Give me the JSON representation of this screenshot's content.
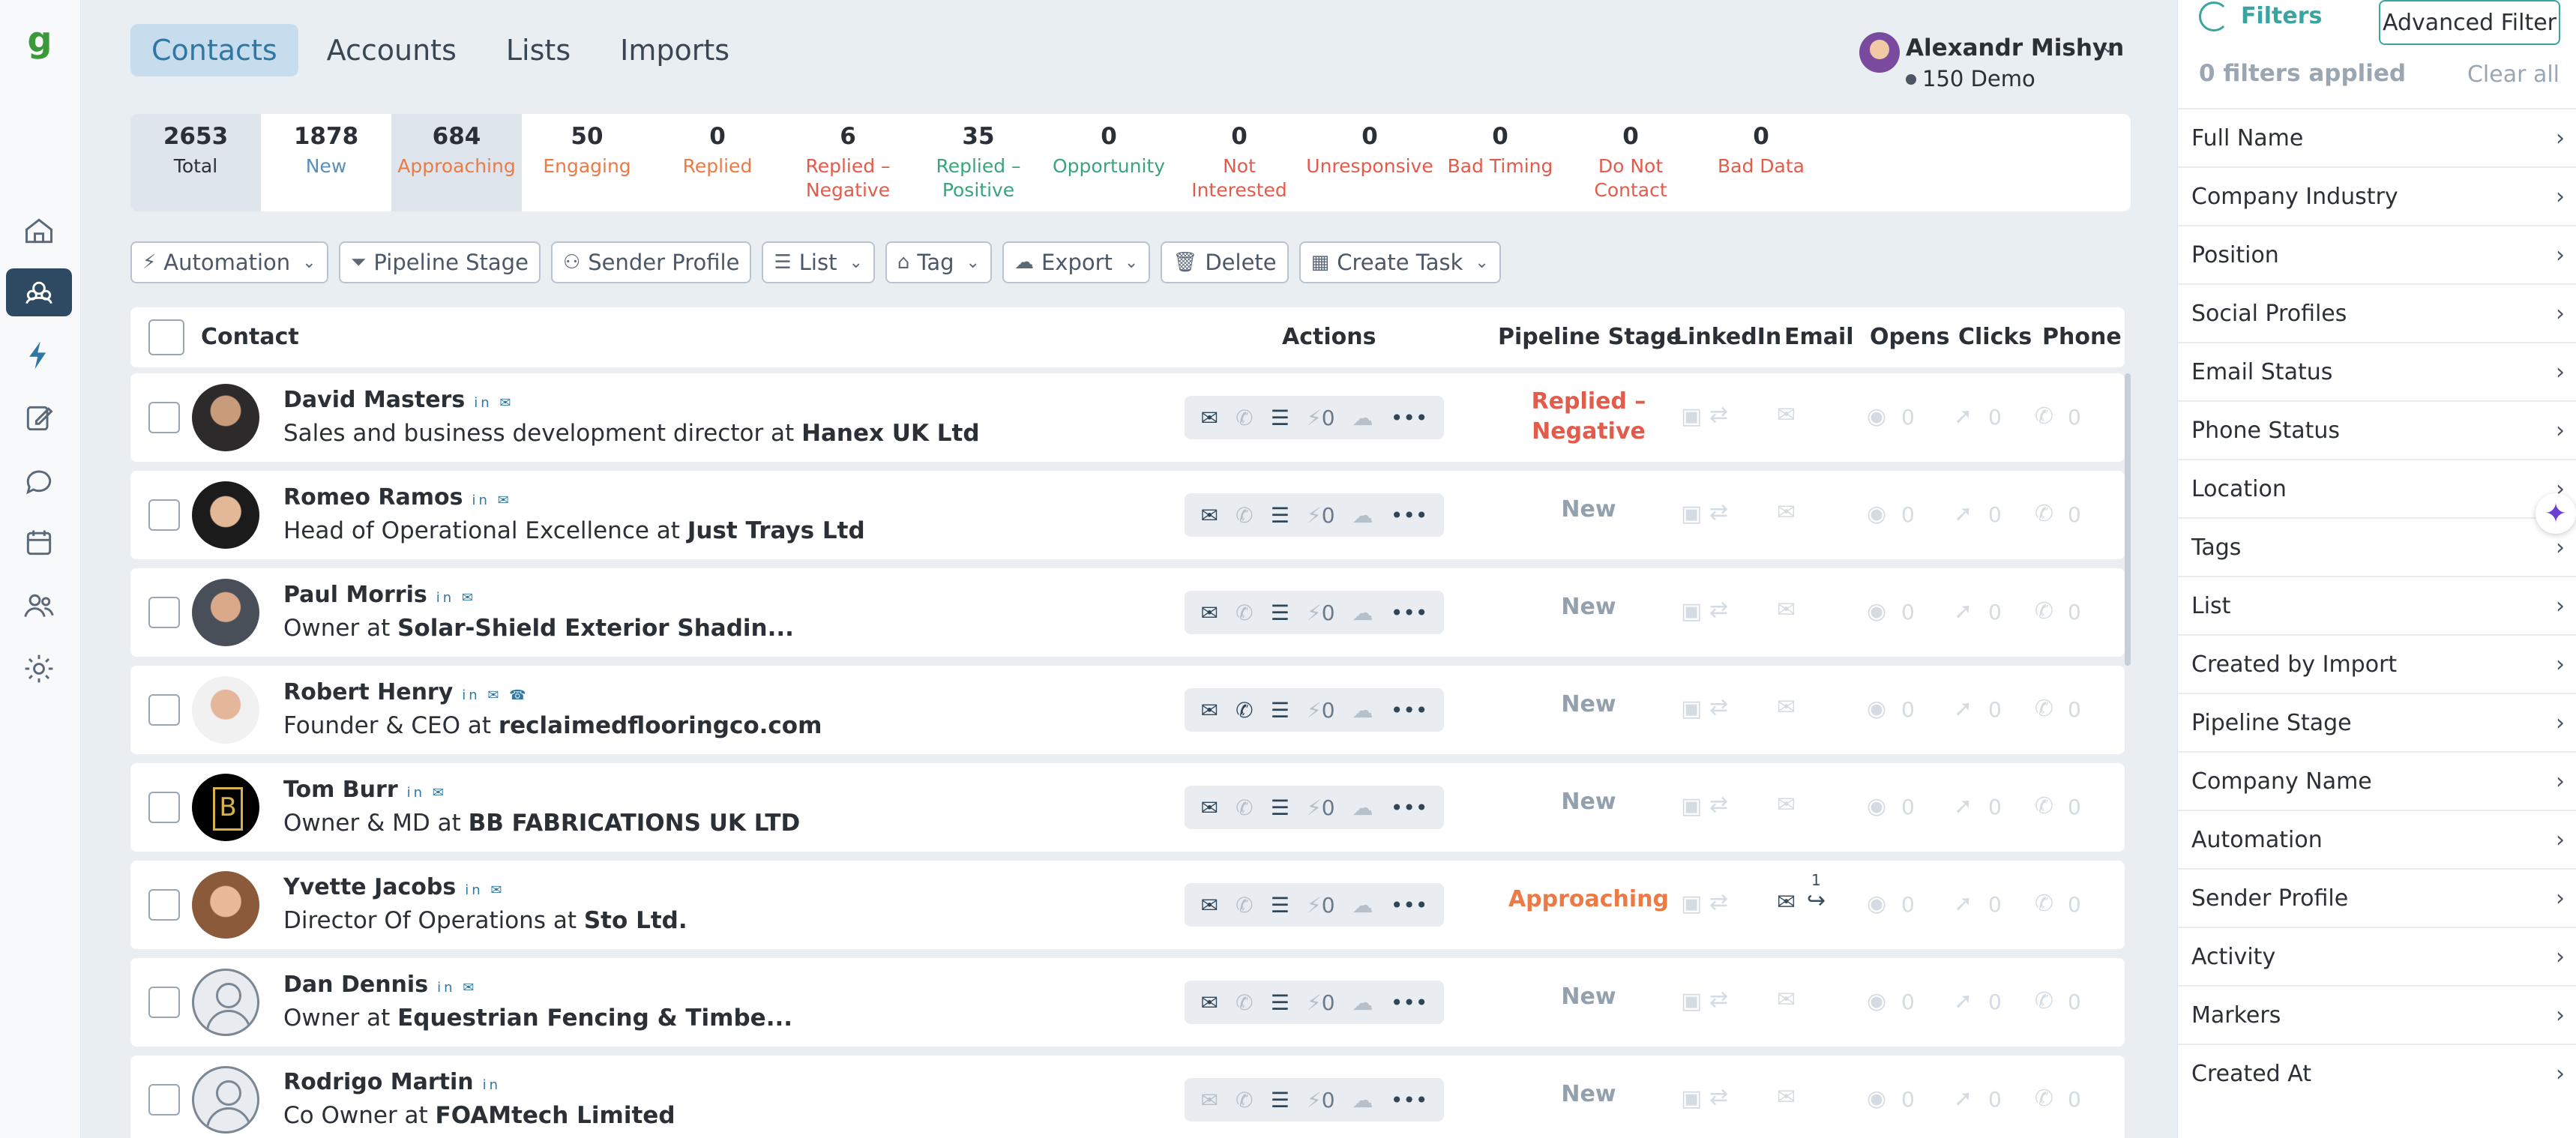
{
  "tabs": [
    {
      "label": "Contacts"
    },
    {
      "label": "Accounts"
    },
    {
      "label": "Lists"
    },
    {
      "label": "Imports"
    }
  ],
  "user": {
    "name": "Alexandr Mishyn",
    "org": "150 Demo"
  },
  "stats": [
    {
      "num": "2653",
      "label": "Total",
      "color": "#2b2f36"
    },
    {
      "num": "1878",
      "label": "New",
      "color": "#5b8fb8"
    },
    {
      "num": "684",
      "label": "Approaching",
      "color": "#ec7a45"
    },
    {
      "num": "50",
      "label": "Engaging",
      "color": "#ec7a45"
    },
    {
      "num": "0",
      "label": "Replied",
      "color": "#ec7a45"
    },
    {
      "num": "6",
      "label": "Replied – Negative",
      "color": "#e25b4b"
    },
    {
      "num": "35",
      "label": "Replied – Positive",
      "color": "#3aa57a"
    },
    {
      "num": "0",
      "label": "Opportunity",
      "color": "#3aa57a"
    },
    {
      "num": "0",
      "label": "Not Interested",
      "color": "#e25b4b"
    },
    {
      "num": "0",
      "label": "Unresponsive",
      "color": "#e25b4b"
    },
    {
      "num": "0",
      "label": "Bad Timing",
      "color": "#e25b4b"
    },
    {
      "num": "0",
      "label": "Do Not Contact",
      "color": "#e25b4b"
    },
    {
      "num": "0",
      "label": "Bad Data",
      "color": "#e25b4b"
    }
  ],
  "toolbar": {
    "automation": "Automation",
    "pipeline_stage": "Pipeline Stage",
    "sender_profile": "Sender Profile",
    "list": "List",
    "tag": "Tag",
    "export": "Export",
    "delete": "Delete",
    "create_task": "Create Task"
  },
  "table": {
    "headers": {
      "contact": "Contact",
      "actions": "Actions",
      "pipeline_stage": "Pipeline Stage",
      "linkedin": "LinkedIn",
      "email": "Email",
      "opens": "Opens",
      "clicks": "Clicks",
      "phone": "Phone"
    },
    "rows": [
      {
        "name": "David Masters",
        "title": "Sales and business development director at ",
        "company": "Hanex UK Ltd",
        "stage": "Replied – Negative",
        "icons": "in ✉",
        "sent": "",
        "sent_count": ""
      },
      {
        "name": "Romeo Ramos",
        "title": "Head of Operational Excellence at ",
        "company": "Just Trays Ltd",
        "stage": "New",
        "icons": "in ✉",
        "sent": "",
        "sent_count": ""
      },
      {
        "name": "Paul Morris",
        "title": "Owner at ",
        "company": "Solar-Shield Exterior Shadin...",
        "stage": "New",
        "icons": "in ✉",
        "sent": "",
        "sent_count": ""
      },
      {
        "name": "Robert Henry",
        "title": "Founder & CEO at ",
        "company": "reclaimedflooringco.com",
        "stage": "New",
        "icons": "in ✉ ☎",
        "sent": "",
        "sent_count": ""
      },
      {
        "name": "Tom Burr",
        "title": "Owner & MD at ",
        "company": "BB FABRICATIONS UK LTD",
        "stage": "New",
        "icons": "in ✉",
        "sent": "",
        "sent_count": ""
      },
      {
        "name": "Yvette Jacobs",
        "title": "Director Of Operations at ",
        "company": "Sto Ltd.",
        "stage": "Approaching",
        "icons": "in ✉",
        "sent": "↪",
        "sent_count": "1"
      },
      {
        "name": "Dan Dennis",
        "title": "Owner at ",
        "company": "Equestrian Fencing & Timbe...",
        "stage": "New",
        "icons": "in ✉",
        "sent": "",
        "sent_count": ""
      },
      {
        "name": "Rodrigo Martin",
        "title": "Co Owner at ",
        "company": "FOAMtech Limited",
        "stage": "New",
        "icons": "in",
        "sent": "",
        "sent_count": ""
      }
    ],
    "zero": "0"
  },
  "filters": {
    "title": "Filters",
    "advanced": "Advanced Filter",
    "applied": "0 filters applied",
    "clear": "Clear all",
    "items": [
      "Full Name",
      "Company Industry",
      "Position",
      "Social Profiles",
      "Email Status",
      "Phone Status",
      "Location",
      "Tags",
      "List",
      "Created by Import",
      "Pipeline Stage",
      "Company Name",
      "Automation",
      "Sender Profile",
      "Activity",
      "Markers",
      "Created At"
    ]
  },
  "colors": {
    "accent": "#3aa5a0",
    "active_tab": "#2f78a6",
    "rail_active": "#2e4a63"
  },
  "icons": {
    "rail": [
      "home-icon",
      "contacts-icon",
      "lightning-icon",
      "compose-icon",
      "chat-icon",
      "calendar-icon",
      "users-icon",
      "gear-icon"
    ],
    "arrow": "›",
    "dropdown": "⌄"
  }
}
